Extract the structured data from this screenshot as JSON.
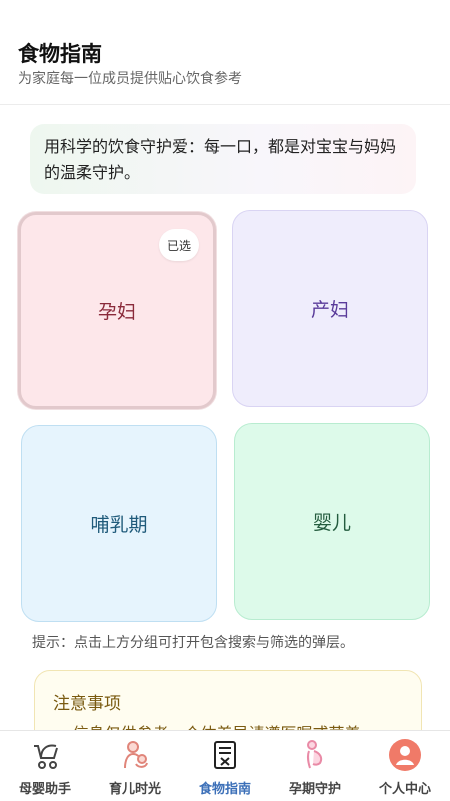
{
  "header": {
    "title": "食物指南",
    "subtitle": "为家庭每一位成员提供贴心饮食参考"
  },
  "quote": "用科学的饮食守护爱：每一口，都是对宝宝与妈妈的温柔守护。",
  "groups": [
    {
      "label": "孕妇",
      "badge": "已选",
      "selected": true
    },
    {
      "label": "产妇"
    },
    {
      "label": "哺乳期"
    },
    {
      "label": "婴儿"
    }
  ],
  "hint": "提示：点击上方分组可打开包含搜索与筛选的弹层。",
  "notice": {
    "title": "注意事项",
    "items": [
      "信息仅供参考，个体差异请遵医嘱或营养"
    ]
  },
  "tabbar": {
    "active": "food-guide",
    "items": [
      {
        "id": "baby-helper",
        "label": "母婴助手",
        "icon": "stroller-icon"
      },
      {
        "id": "parenting",
        "label": "育儿时光",
        "icon": "mother-baby-icon"
      },
      {
        "id": "food-guide",
        "label": "食物指南",
        "icon": "food-list-icon"
      },
      {
        "id": "pregnancy",
        "label": "孕期守护",
        "icon": "pregnant-woman-icon"
      },
      {
        "id": "profile",
        "label": "个人中心",
        "icon": "user-avatar-icon"
      }
    ]
  },
  "colors": {
    "accent": "#3b6fb8",
    "pregnant_bg": "#fde7ea",
    "postpartum_bg": "#efedfc",
    "lactation_bg": "#e6f4fd",
    "infant_bg": "#ddfaea",
    "profile_icon": "#f07a68"
  }
}
